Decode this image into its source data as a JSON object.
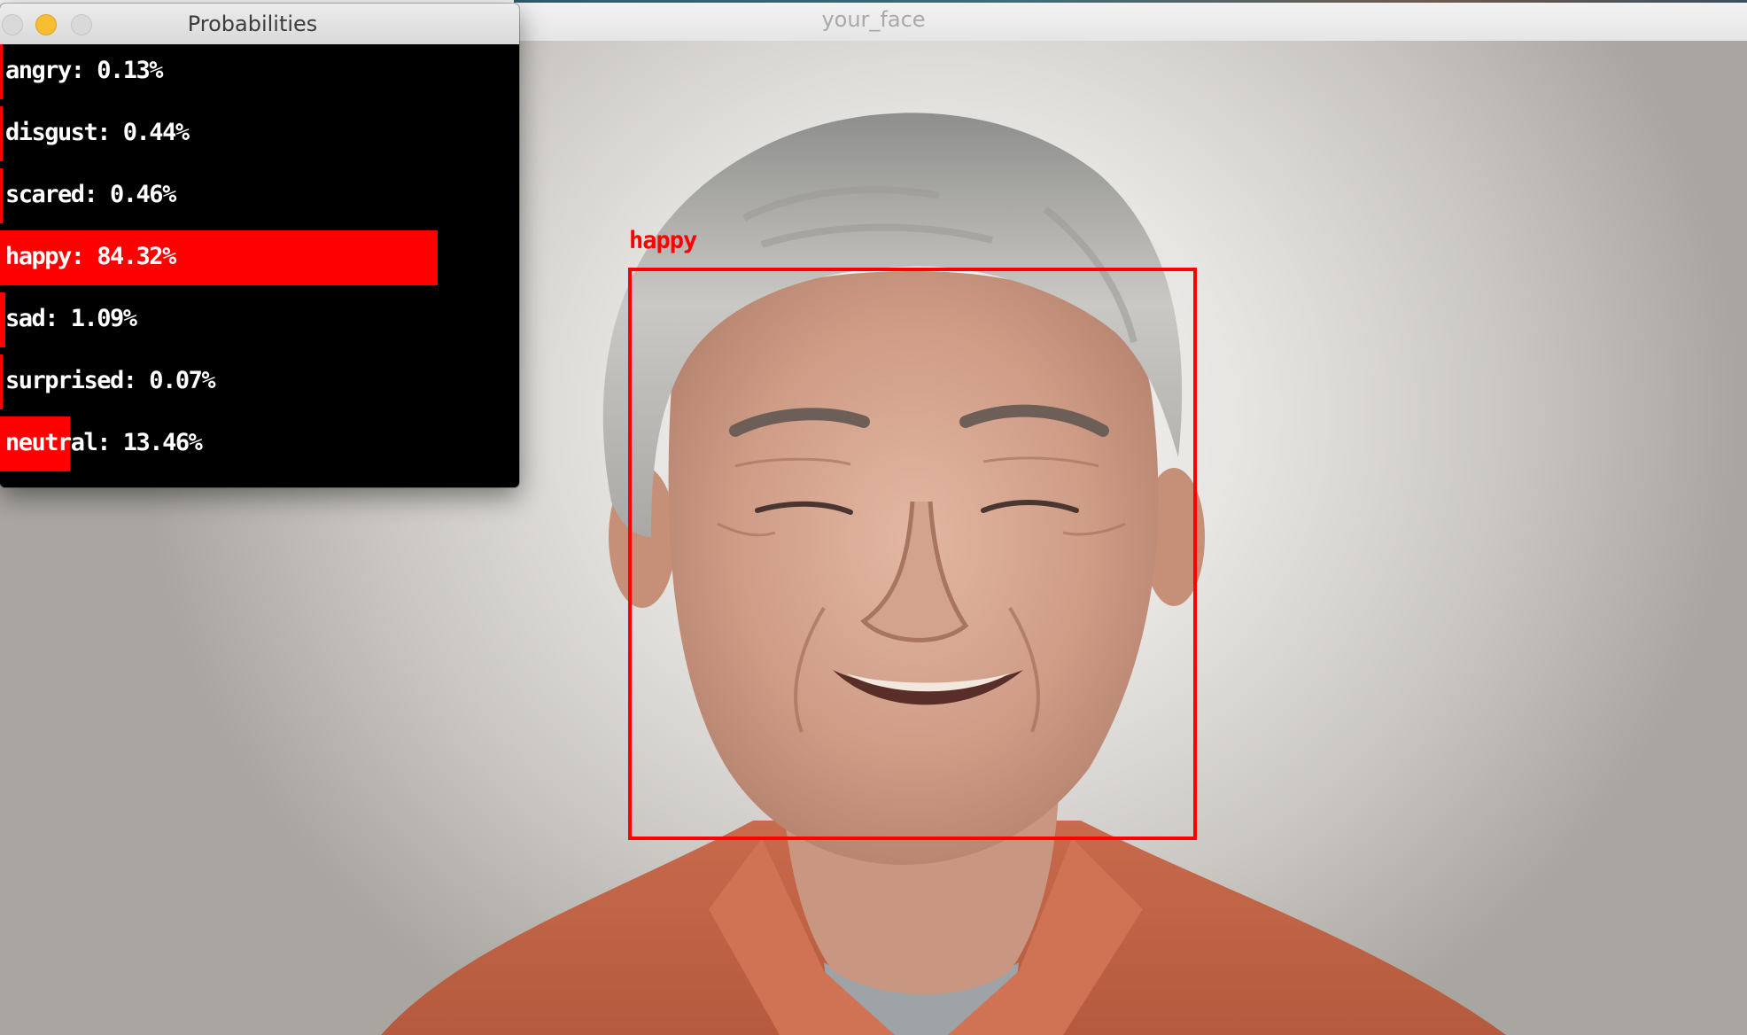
{
  "face_window": {
    "title": "your_face",
    "detection": {
      "label": "happy",
      "box_color": "#ff0000"
    }
  },
  "prob_window": {
    "title": "Probabilities",
    "bar_color": "#ff0000",
    "rows": [
      {
        "label": "angry",
        "value_text": "0.13%",
        "value": 0.0013
      },
      {
        "label": "disgust",
        "value_text": "0.44%",
        "value": 0.0044
      },
      {
        "label": "scared",
        "value_text": "0.46%",
        "value": 0.0046
      },
      {
        "label": "happy",
        "value_text": "84.32%",
        "value": 0.8432
      },
      {
        "label": "sad",
        "value_text": "1.09%",
        "value": 0.0109
      },
      {
        "label": "surprised",
        "value_text": "0.07%",
        "value": 0.0007
      },
      {
        "label": "neutral",
        "value_text": "13.46%",
        "value": 0.1346
      }
    ]
  }
}
